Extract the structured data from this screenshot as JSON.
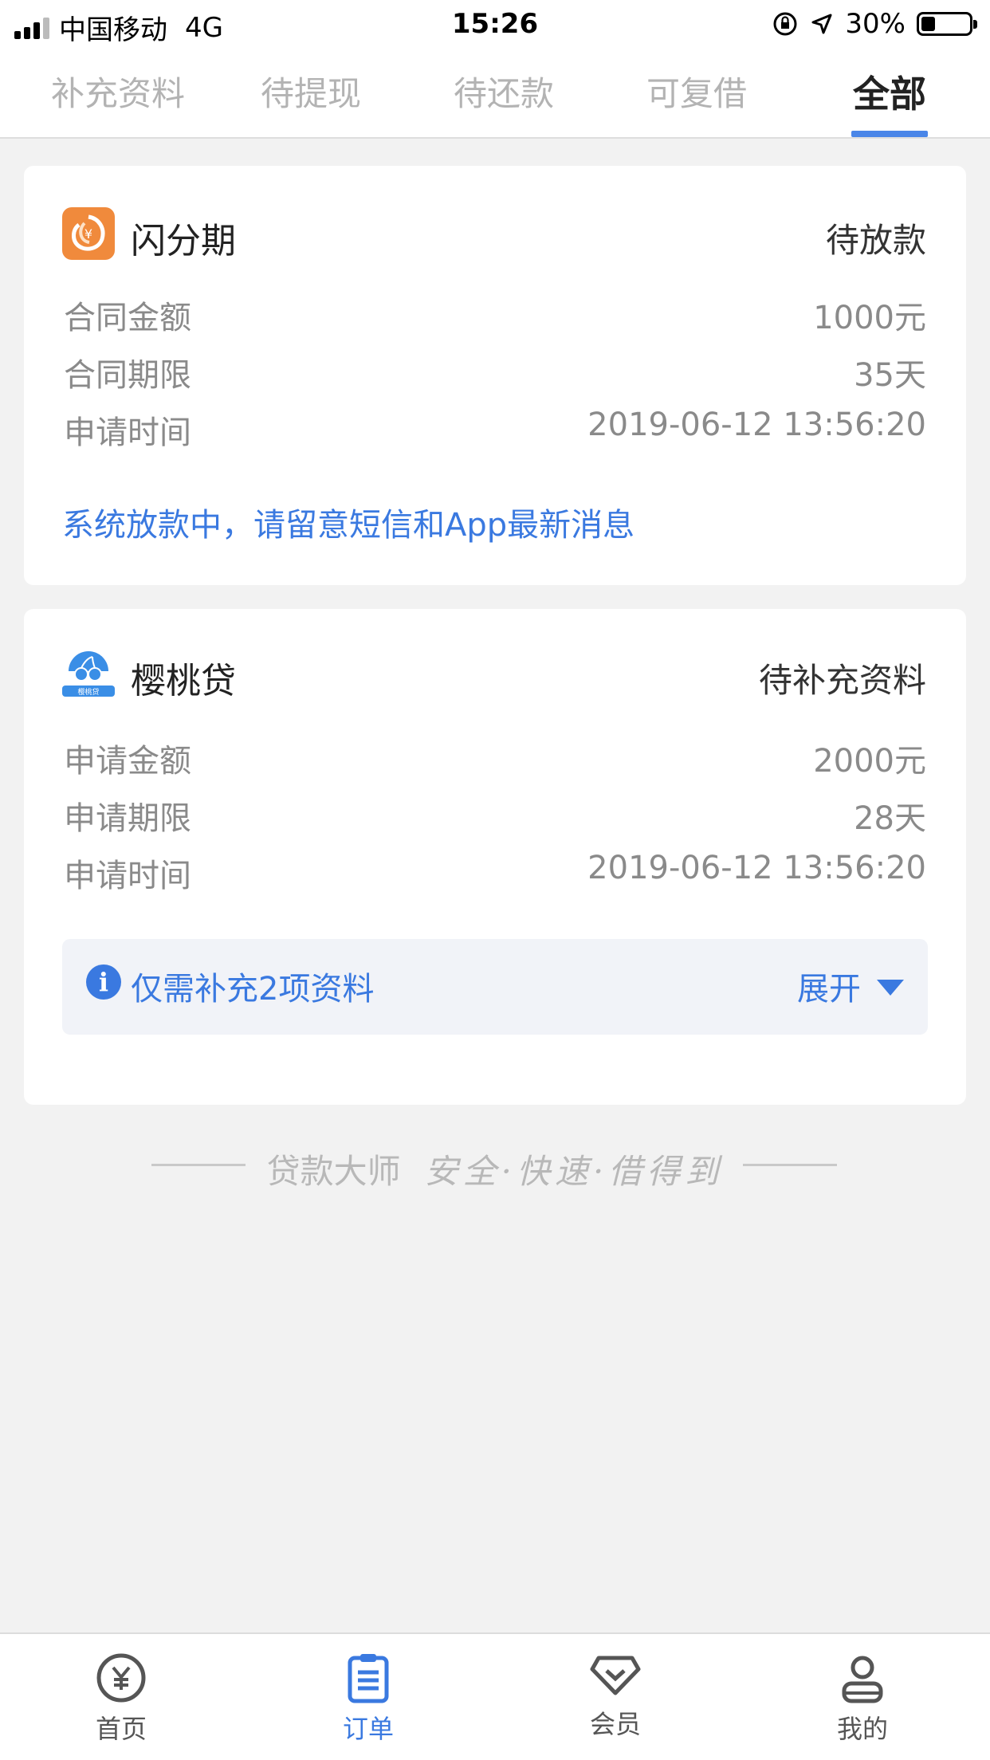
{
  "status_bar": {
    "carrier": "中国移动",
    "network": "4G",
    "time": "15:26",
    "battery_percent": "30%",
    "battery_level": 0.3
  },
  "tabs": [
    {
      "label": "补充资料",
      "active": false
    },
    {
      "label": "待提现",
      "active": false
    },
    {
      "label": "待还款",
      "active": false
    },
    {
      "label": "可复借",
      "active": false
    },
    {
      "label": "全部",
      "active": true
    }
  ],
  "orders": [
    {
      "brand": "闪分期",
      "status": "待放款",
      "rows": [
        {
          "label": "合同金额",
          "value": "1000元"
        },
        {
          "label": "合同期限",
          "value": "35天"
        },
        {
          "label": "申请时间",
          "value": "2019-06-12 13:56:20"
        }
      ],
      "notice": "系统放款中，请留意短信和App最新消息",
      "logo_color": "#f08a3c"
    },
    {
      "brand": "樱桃贷",
      "status": "待补充资料",
      "rows": [
        {
          "label": "申请金额",
          "value": "2000元"
        },
        {
          "label": "申请期限",
          "value": "28天"
        },
        {
          "label": "申请时间",
          "value": "2019-06-12 13:56:20"
        }
      ],
      "logo_caption": "樱桃贷",
      "supplement": {
        "text": "仅需补充2项资料",
        "expand_label": "展开"
      },
      "logo_color": "#3a8ee6"
    }
  ],
  "slogan": {
    "brand": "贷款大师",
    "script": "安全·快速·借得到"
  },
  "bottom_nav": [
    {
      "label": "首页",
      "icon": "yen-circle-icon",
      "active": false
    },
    {
      "label": "订单",
      "icon": "clipboard-icon",
      "active": true
    },
    {
      "label": "会员",
      "icon": "diamond-icon",
      "active": false
    },
    {
      "label": "我的",
      "icon": "person-icon",
      "active": false
    }
  ],
  "colors": {
    "accent": "#3a79e0",
    "tab_underline": "#4a86e8",
    "background": "#f2f2f2"
  }
}
